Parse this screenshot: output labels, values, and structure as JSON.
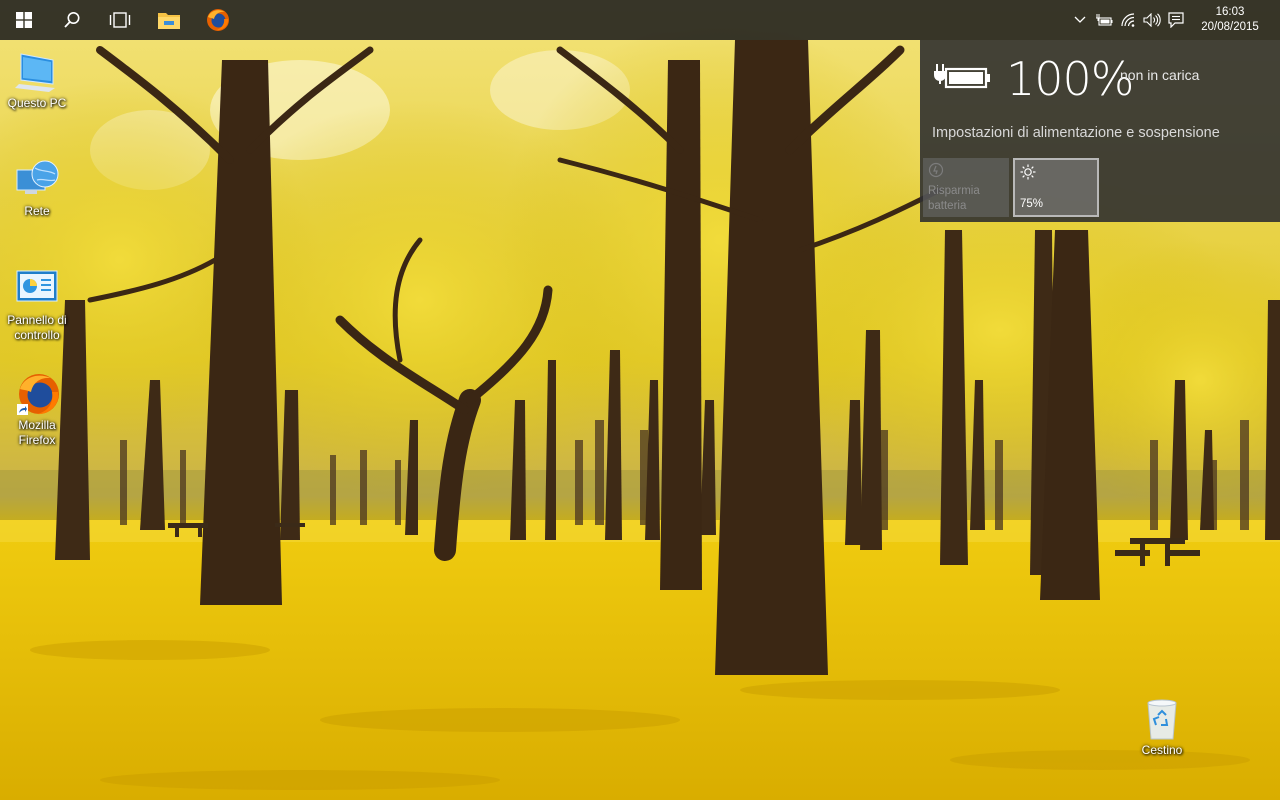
{
  "taskbar": {
    "start": {
      "icon": "windows-start-icon"
    },
    "search": {
      "icon": "search-icon"
    },
    "task_view": {
      "icon": "task-view-icon"
    },
    "pinned": [
      {
        "name": "Esplora file",
        "icon": "file-explorer-icon"
      },
      {
        "name": "Mozilla Firefox",
        "icon": "firefox-icon"
      }
    ],
    "tray": {
      "icons": [
        "chevron-up-icon",
        "battery-icon",
        "wifi-icon",
        "volume-icon",
        "action-center-icon"
      ],
      "time": "16:03",
      "date": "20/08/2015"
    }
  },
  "battery_flyout": {
    "percent": "100%",
    "status": "non in carica",
    "settings_link": "Impostazioni di alimentazione e sospensione",
    "tiles": [
      {
        "label": "Risparmia batteria",
        "label_line1": "Risparmia",
        "label_line2": "batteria",
        "state": "disabled"
      },
      {
        "label": "75%",
        "icon": "brightness-icon",
        "state": "active"
      }
    ]
  },
  "desktop": {
    "icons": [
      {
        "label": "Questo PC",
        "icon": "this-pc-icon"
      },
      {
        "label": "Rete",
        "icon": "network-icon"
      },
      {
        "label": "Pannello di controllo",
        "label_line1": "Pannello di",
        "label_line2": "controllo",
        "icon": "control-panel-icon"
      },
      {
        "label": "Mozilla Firefox",
        "label_line1": "Mozilla",
        "label_line2": "Firefox",
        "icon": "firefox-shortcut-icon"
      },
      {
        "label": "Cestino",
        "icon": "recycle-bin-icon"
      }
    ]
  },
  "colors": {
    "taskbar_bg": "#1c1c1c",
    "flyout_bg": "#303030",
    "wallpaper_leaves": "#e8c400",
    "trunk": "#3e2a16"
  }
}
